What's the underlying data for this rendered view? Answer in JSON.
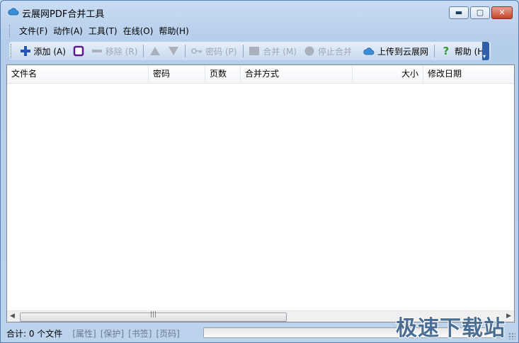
{
  "window": {
    "title": "云展网PDF合并工具"
  },
  "menu": [
    "文件(F)",
    "动作(A)",
    "工具(T)",
    "在线(O)",
    "帮助(H)"
  ],
  "toolbar": {
    "add": "添加 (A)",
    "remove": "移除 (R)",
    "password": "密码 (P)",
    "merge": "合并 (M)",
    "stop": "停止合并",
    "upload": "上传到云展网",
    "help": "帮助 (H)"
  },
  "columns": [
    "文件名",
    "密码",
    "页数",
    "合并方式",
    "",
    "大小",
    "修改日期"
  ],
  "status": {
    "summary": "合计:  0 个文件",
    "tags": [
      "[属性]",
      "[保护]",
      "[书签]",
      "[页码]"
    ]
  },
  "watermark": "极速下载站",
  "colors": {
    "accent": "#2f5fa8",
    "help_green": "#2e9a2e",
    "add_blue": "#2456b8"
  }
}
